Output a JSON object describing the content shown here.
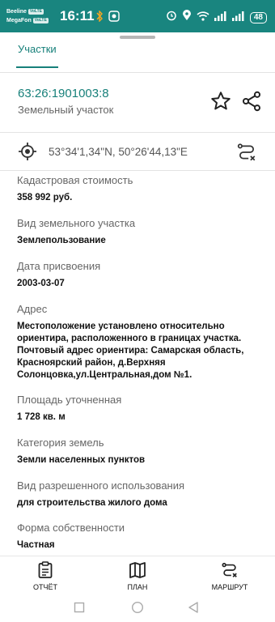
{
  "status_bar": {
    "carrier1": "Beeline",
    "carrier2": "MegaFon",
    "network_tag": "VoLTE",
    "time": "16:11",
    "battery": "48"
  },
  "tab": {
    "label": "Участки"
  },
  "parcel": {
    "cadastral_number": "63:26:1901003:8",
    "type": "Земельный участок"
  },
  "coordinates": "53°34'1,34\"N, 50°26'44,13\"E",
  "fields": [
    {
      "label": "Кадастровая стоимость",
      "value": "358 992 руб."
    },
    {
      "label": "Вид земельного участка",
      "value": "Землепользование"
    },
    {
      "label": "Дата присвоения",
      "value": "2003-03-07"
    },
    {
      "label": "Адрес",
      "value": "Местоположение установлено относительно ориентира, расположенного в границах участка. Почтовый адрес ориентира: Самарская область, Красноярский район, д.Верхняя Солонцовка,ул.Центральная,дом №1."
    },
    {
      "label": "Площадь уточненная",
      "value": "1 728 кв. м"
    },
    {
      "label": "Категория земель",
      "value": "Земли населенных пунктов"
    },
    {
      "label": "Вид разрешенного использования",
      "value": "для строительства жилого дома"
    },
    {
      "label": "Форма собственности",
      "value": "Частная"
    }
  ],
  "bottom_nav": [
    {
      "label": "ОТЧЁТ",
      "icon": "report-icon"
    },
    {
      "label": "ПЛАН",
      "icon": "map-icon"
    },
    {
      "label": "МАРШРУТ",
      "icon": "route-icon"
    }
  ],
  "colors": {
    "accent": "#17807a",
    "status_bar": "#19857f"
  }
}
